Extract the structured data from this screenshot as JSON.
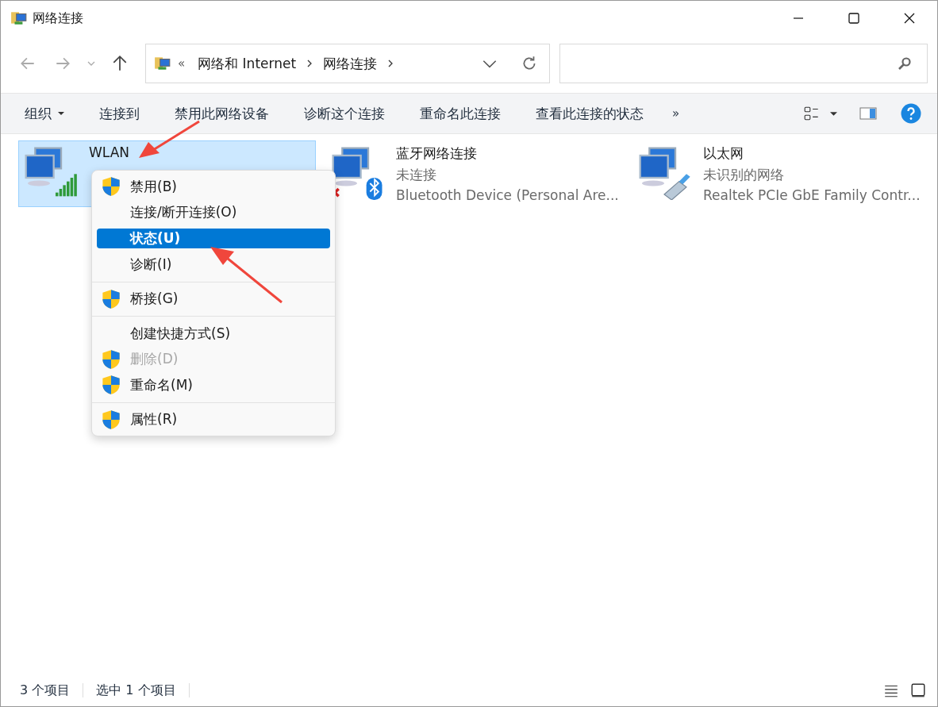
{
  "window": {
    "title": "网络连接"
  },
  "address": {
    "overflow": "«",
    "crumbs": [
      "网络和 Internet",
      "网络连接"
    ]
  },
  "toolbar": {
    "items": [
      {
        "label": "组织",
        "dropdown": true
      },
      {
        "label": "连接到",
        "dropdown": false
      },
      {
        "label": "禁用此网络设备",
        "dropdown": false
      },
      {
        "label": "诊断这个连接",
        "dropdown": false
      },
      {
        "label": "重命名此连接",
        "dropdown": false
      },
      {
        "label": "查看此连接的状态",
        "dropdown": false
      }
    ],
    "more": "»"
  },
  "connections": [
    {
      "kind": "wifi",
      "name": "WLAN",
      "selected": true
    },
    {
      "kind": "bluetooth",
      "name": "蓝牙网络连接",
      "status": "未连接",
      "device": "Bluetooth Device (Personal Are...",
      "selected": false
    },
    {
      "kind": "ethernet",
      "name": "以太网",
      "status": "未识别的网络",
      "device": "Realtek PCIe GbE Family Contr...",
      "selected": false
    }
  ],
  "context_menu": {
    "groups": [
      [
        {
          "label": "禁用(B)",
          "shield": true,
          "disabled": false,
          "selected": false
        },
        {
          "label": "连接/断开连接(O)",
          "shield": false,
          "disabled": false,
          "selected": false
        },
        {
          "label": "状态(U)",
          "shield": false,
          "disabled": false,
          "selected": true
        },
        {
          "label": "诊断(I)",
          "shield": false,
          "disabled": false,
          "selected": false
        }
      ],
      [
        {
          "label": "桥接(G)",
          "shield": true,
          "disabled": false,
          "selected": false
        }
      ],
      [
        {
          "label": "创建快捷方式(S)",
          "shield": false,
          "disabled": false,
          "selected": false
        },
        {
          "label": "删除(D)",
          "shield": true,
          "disabled": true,
          "selected": false
        },
        {
          "label": "重命名(M)",
          "shield": true,
          "disabled": false,
          "selected": false
        }
      ],
      [
        {
          "label": "属性(R)",
          "shield": true,
          "disabled": false,
          "selected": false
        }
      ]
    ]
  },
  "status_bar": {
    "count": "3 个项目",
    "selection": "选中 1 个项目"
  }
}
